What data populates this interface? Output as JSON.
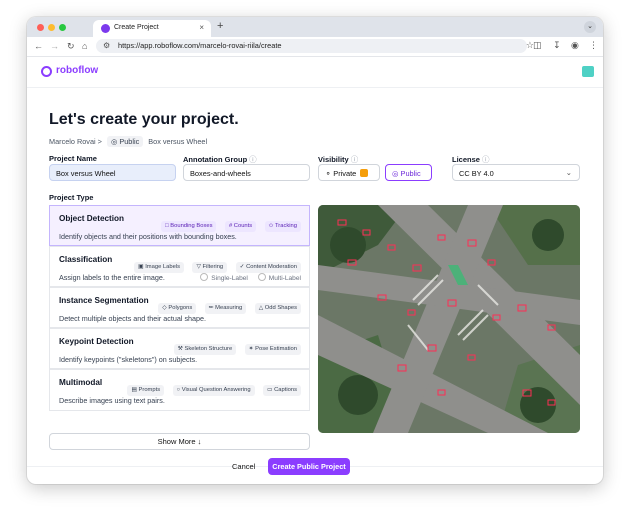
{
  "browser": {
    "tab_title": "Create Project",
    "url": "https://app.roboflow.com/marcelo-rovai-riila/create",
    "new_tab": "+",
    "tab_close": "×"
  },
  "app": {
    "logo_text": "roboflow"
  },
  "page": {
    "title": "Let's create your project.",
    "breadcrumb": {
      "owner": "Marcelo Rovai",
      "separator": ">",
      "visibility": "Public",
      "project": "Box versus Wheel"
    }
  },
  "form": {
    "project_name": {
      "label": "Project Name",
      "value": "Box versus Wheel"
    },
    "annotation_group": {
      "label": "Annotation Group",
      "value": "Boxes-and-wheels"
    },
    "visibility": {
      "label": "Visibility",
      "private_label": "Private",
      "public_label": "Public",
      "selected": "Public"
    },
    "license": {
      "label": "License",
      "value": "CC BY 4.0"
    }
  },
  "project_type": {
    "label": "Project Type",
    "types": [
      {
        "name": "Object Detection",
        "desc": "Identify objects and their positions with bounding boxes.",
        "chips": [
          "Bounding Boxes",
          "Counts",
          "Tracking"
        ],
        "selected": true
      },
      {
        "name": "Classification",
        "desc": "Assign labels to the entire image.",
        "chips": [
          "Image Labels",
          "Filtering",
          "Content Moderation"
        ],
        "options": [
          "Single-Label",
          "Multi-Label"
        ]
      },
      {
        "name": "Instance Segmentation",
        "desc": "Detect multiple objects and their actual shape.",
        "chips": [
          "Polygons",
          "Measuring",
          "Odd Shapes"
        ]
      },
      {
        "name": "Keypoint Detection",
        "desc": "Identify keypoints (\"skeletons\") on subjects.",
        "chips": [
          "Skeleton Structure",
          "Pose Estimation"
        ]
      },
      {
        "name": "Multimodal",
        "desc": "Describe images using text pairs.",
        "chips": [
          "Prompts",
          "Visual Question Answering",
          "Captions"
        ]
      }
    ],
    "show_more": "Show More ↓"
  },
  "footer": {
    "cancel": "Cancel",
    "create": "Create Public Project"
  },
  "colors": {
    "accent": "#8b3dff",
    "selected_bg": "#f5f0ff"
  }
}
